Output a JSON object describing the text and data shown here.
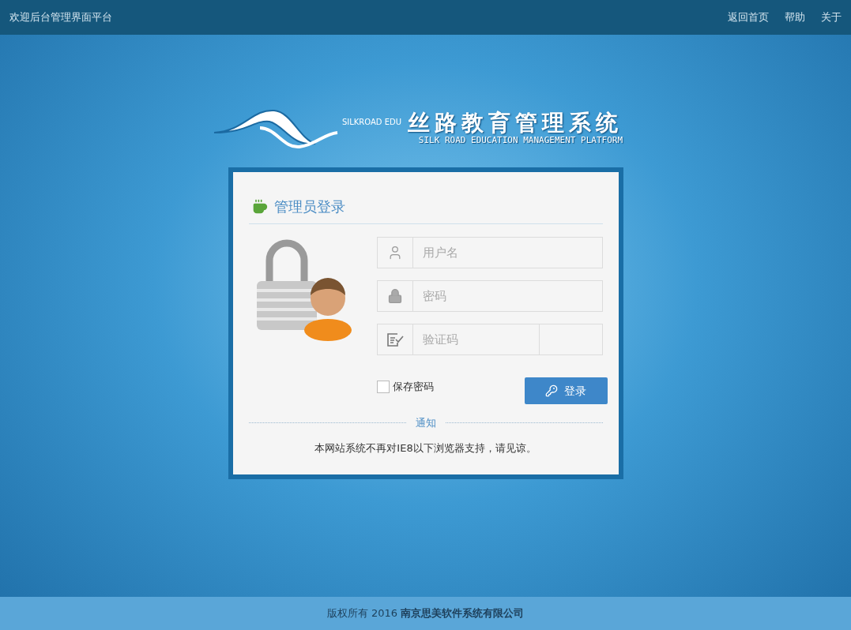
{
  "top_bar": {
    "title": "欢迎后台管理界面平台",
    "links": [
      "返回首页",
      "帮助",
      "关于"
    ]
  },
  "logo": {
    "badge": "SILKROAD EDU",
    "title": "丝路教育管理系统",
    "subtitle": "SILK ROAD EDUCATION MANAGEMENT PLATFORM"
  },
  "login": {
    "heading": "管理员登录",
    "fields": [
      {
        "kind": "user",
        "placeholder": "用户名"
      },
      {
        "kind": "password",
        "placeholder": "密码"
      },
      {
        "kind": "captcha",
        "placeholder": "验证码"
      }
    ],
    "remember": {
      "label": "保存密码",
      "checked": false
    },
    "submit": "登录",
    "notice_label": "通知",
    "notice": "本网站系统不再对IE8以下浏览器支持，请见谅。"
  },
  "footer": "版权所有 2016 **南京思美软件系统有限公司**"
}
